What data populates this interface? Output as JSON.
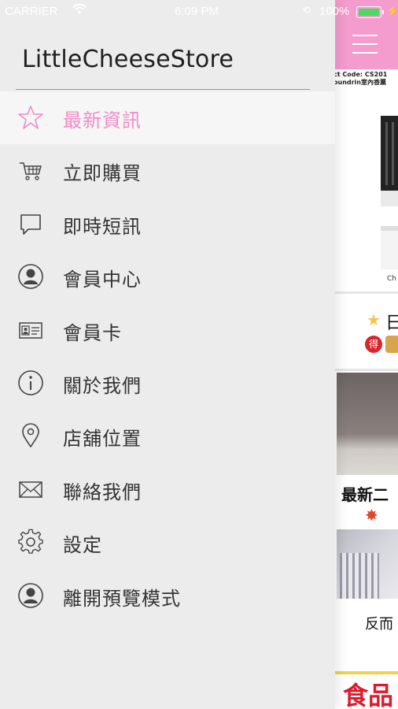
{
  "status_bar": {
    "carrier": "CARRIER",
    "time": "6:09 PM",
    "battery_percent": "100%",
    "battery_level": 1.0
  },
  "drawer": {
    "title": "LittleCheeseStore",
    "items": [
      {
        "label": "最新資訊",
        "icon": "star-icon",
        "active": true
      },
      {
        "label": "立即購買",
        "icon": "cart-icon"
      },
      {
        "label": "即時短訊",
        "icon": "chat-bubble-icon"
      },
      {
        "label": "會員中心",
        "icon": "user-circle-icon"
      },
      {
        "label": "會員卡",
        "icon": "member-card-icon"
      },
      {
        "label": "關於我們",
        "icon": "info-icon"
      },
      {
        "label": "店舖位置",
        "icon": "location-pin-icon"
      },
      {
        "label": "聯絡我們",
        "icon": "envelope-icon"
      },
      {
        "label": "設定",
        "icon": "gear-icon"
      },
      {
        "label": "離開預覽模式",
        "icon": "user-circle-icon"
      }
    ]
  },
  "content": {
    "product_code_line1": "ct Code: CS201",
    "product_code_line2": "oundrin室內香薰",
    "product_caption": "Ch",
    "text_ri": "日",
    "badge_de": "得",
    "text_newest": "最新二",
    "text_fan": "反而",
    "food_banner": "食品"
  },
  "colors": {
    "accent_pink": "#ef8cc7",
    "header_pink": "#f49ccd",
    "drawer_bg": "#ececec",
    "active_row_bg": "#f6f6f6"
  }
}
